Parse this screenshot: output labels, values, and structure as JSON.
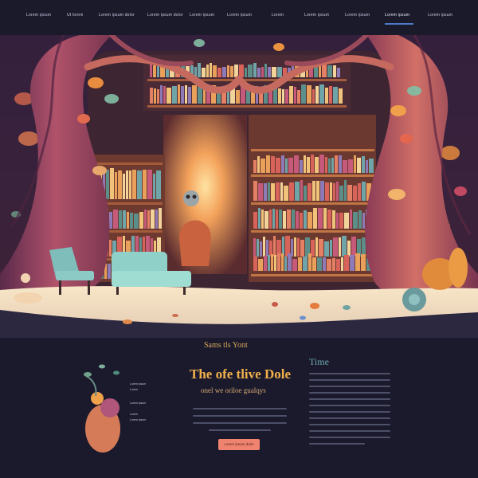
{
  "nav": {
    "items": [
      "Lorem ipsum",
      "Ut lorem",
      "Lorem ipsum dolor",
      "Lorem ipsum dolor",
      "Lorem ipsum",
      "Lorem ipsum",
      "Lorem",
      "Lorem ipsum",
      "Lorem ipsum",
      "Lorem ipsum",
      "Lorem ipsum"
    ],
    "active_index": 9
  },
  "content": {
    "eyebrow": "Sams tls Yont",
    "headline": "The ofe tlive Dole",
    "subheadline": "onel we oriloe gualqys",
    "sidebar_title": "Time",
    "cta_label": "Lorem ipsum dolor",
    "mini_labels": [
      "Lorem ipsum",
      "Lorem",
      "Lorem ipsum",
      "Lorem",
      "Lorem ipsum"
    ]
  },
  "colors": {
    "background": "#1b1a2c",
    "accent_gold": "#f1b04c",
    "accent_teal": "#6fa7b0",
    "cta": "#f08370"
  }
}
